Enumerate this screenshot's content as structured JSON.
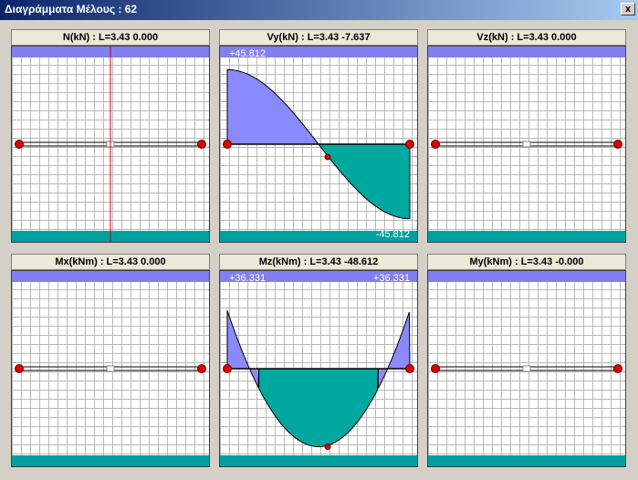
{
  "window": {
    "title": "Διαγράμματα Μέλους : 62",
    "close_label": "x"
  },
  "colors": {
    "top_band": "#8080f0",
    "bottom_band": "#00a0a0",
    "fill_positive": "#8a8aff",
    "fill_negative": "#00a8a0",
    "grid": "#b8b8b8",
    "axis": "#000000",
    "node": "#e00000",
    "vertical_line": "#c00000"
  },
  "panels": [
    {
      "title": "N(kN) : L=3.43 0.000",
      "top_label": "",
      "top_right_label": "",
      "bottom_label": "",
      "shape": "zero_vertical"
    },
    {
      "title": "Vy(kN) : L=3.43 -7.637",
      "top_label": "+45.812",
      "top_right_label": "",
      "bottom_label": "-45.812",
      "shape": "shear",
      "max": 45.812,
      "min": -45.812,
      "zero_at": 0.5
    },
    {
      "title": "Vz(kN) : L=3.43 0.000",
      "top_label": "",
      "top_right_label": "",
      "bottom_label": "",
      "shape": "zero"
    },
    {
      "title": "Mx(kNm) : L=3.43 0.000",
      "top_label": "",
      "top_right_label": "",
      "bottom_label": "",
      "shape": "zero"
    },
    {
      "title": "Mz(kNm) : L=3.43 -48.612",
      "top_label": "+36.331",
      "top_right_label": "+36.331",
      "bottom_label": "",
      "shape": "moment",
      "end_value": 36.331,
      "mid_value": -48.612
    },
    {
      "title": "My(kNm) : L=3.43 -0.000",
      "top_label": "",
      "top_right_label": "",
      "bottom_label": "",
      "shape": "zero"
    }
  ]
}
